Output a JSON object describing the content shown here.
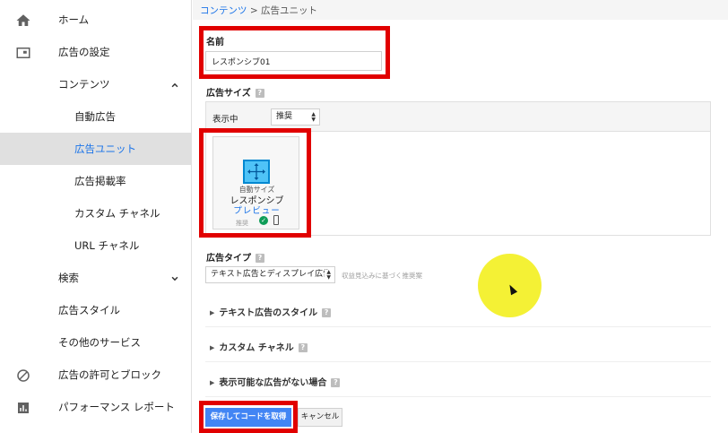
{
  "sidebar": {
    "items": [
      {
        "label": "ホーム",
        "icon": "home-icon"
      },
      {
        "label": "広告の設定",
        "icon": "ad-settings-icon"
      },
      {
        "label": "コンテンツ",
        "icon": "chevron-up-icon"
      },
      {
        "label": "自動広告"
      },
      {
        "label": "広告ユニット"
      },
      {
        "label": "広告掲載率"
      },
      {
        "label": "カスタム チャネル"
      },
      {
        "label": "URL チャネル"
      },
      {
        "label": "検索",
        "icon": "chevron-down-icon"
      },
      {
        "label": "広告スタイル"
      },
      {
        "label": "その他のサービス"
      },
      {
        "label": "広告の許可とブロック",
        "icon": "block-icon"
      },
      {
        "label": "パフォーマンス レポート",
        "icon": "bar-chart-icon"
      }
    ]
  },
  "breadcrumb": {
    "link": "コンテンツ",
    "separator": " > ",
    "current": "広告ユニット"
  },
  "form": {
    "name_label": "名前",
    "name_value": "レスポンシブ01",
    "size_label": "広告サイズ",
    "show_label": "表示中",
    "show_select": "推奨",
    "card": {
      "line1": "自動サイズ",
      "line2": "レスポンシブ",
      "preview": "プレビュー",
      "recommended": "推奨"
    },
    "type_label": "広告タイプ",
    "type_select": "テキスト広告とディスプレイ広告",
    "type_hint": "収益見込みに基づく推奨案",
    "sections": [
      "テキスト広告のスタイル",
      "カスタム チャネル",
      "表示可能な広告がない場合"
    ],
    "help_glyph": "?",
    "save_button": "保存してコードを取得",
    "cancel_button": "キャンセル"
  },
  "colors": {
    "accent": "#1a73e8",
    "primary_button": "#4285f4",
    "highlight": "#e10000",
    "cursor": "#f3f024"
  }
}
